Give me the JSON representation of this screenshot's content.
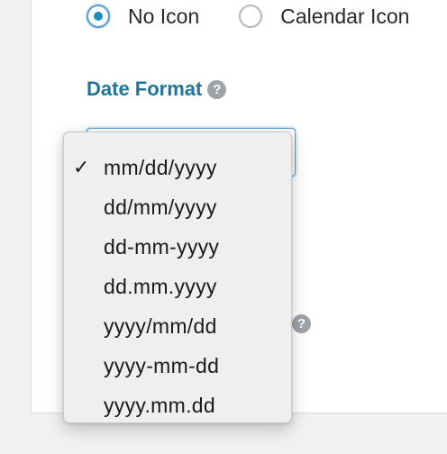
{
  "icon_type": {
    "options": [
      {
        "label": "No Icon",
        "checked": true
      },
      {
        "label": "Calendar Icon",
        "checked": false
      }
    ]
  },
  "date_format": {
    "label": "Date Format",
    "help_symbol": "?",
    "selected": "mm/dd/yyyy",
    "check_symbol": "✓",
    "options": [
      "mm/dd/yyyy",
      "dd/mm/yyyy",
      "dd-mm-yyyy",
      "dd.mm.yyyy",
      "yyyy/mm/dd",
      "yyyy-mm-dd",
      "yyyy.mm.dd"
    ]
  },
  "hidden_field": {
    "help_symbol": "?"
  },
  "colors": {
    "label_blue": "#21759b",
    "radio_dot": "#1e8cbe",
    "focus_border": "#5b9dd9",
    "menu_bg": "#efefef",
    "page_bg": "#f1f1f1"
  }
}
